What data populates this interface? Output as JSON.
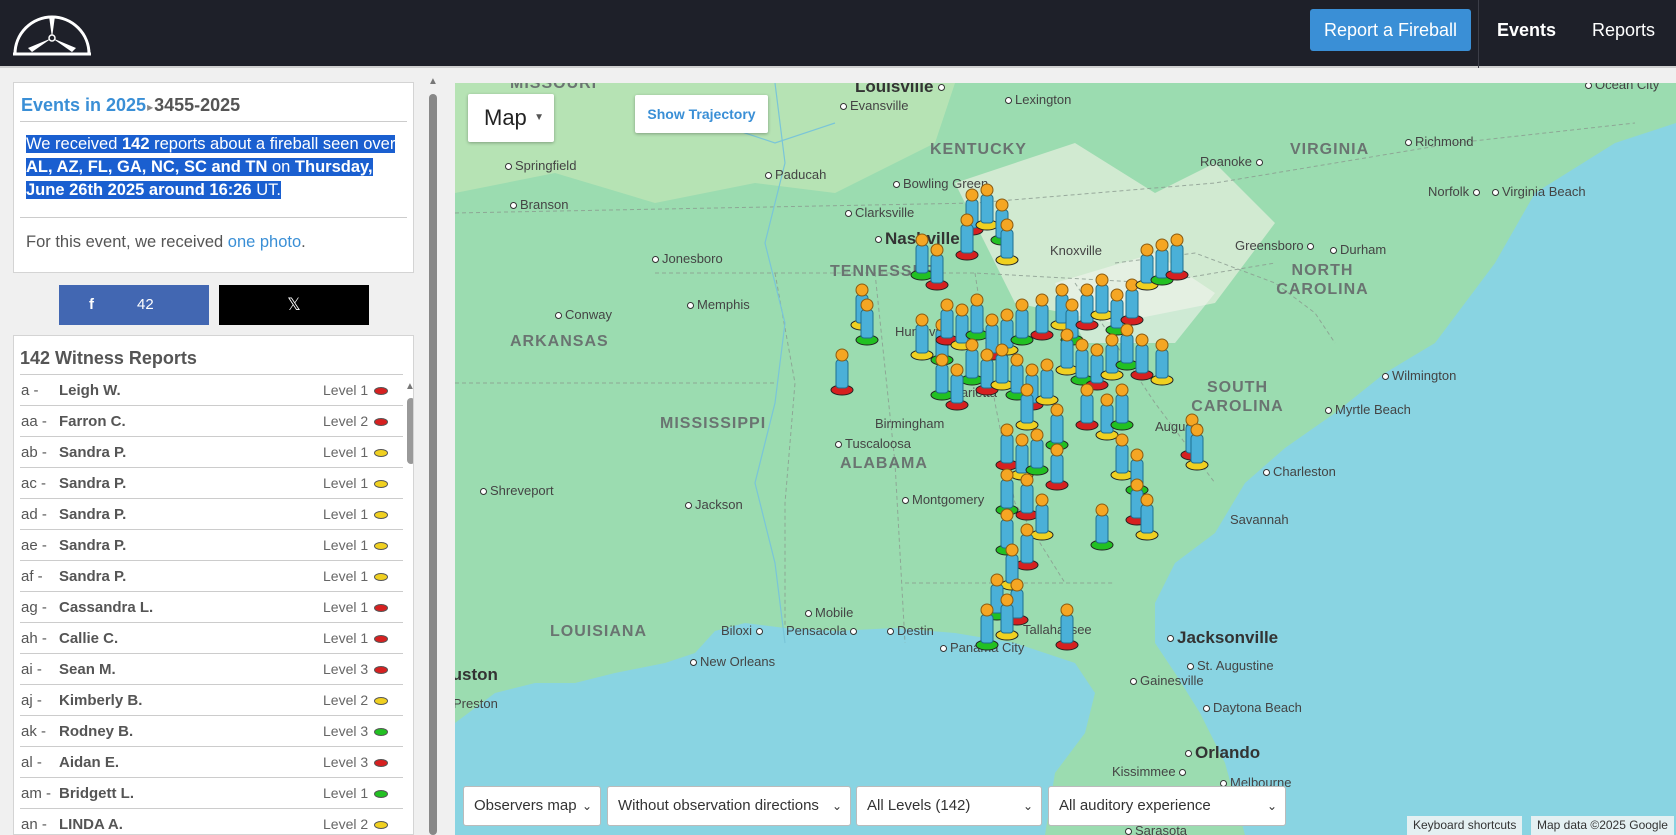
{
  "nav": {
    "report_button": "Report a Fireball",
    "events": "Events",
    "reports": "Reports"
  },
  "event": {
    "breadcrumb_link": "Events in 2025",
    "breadcrumb_sep": "▸",
    "breadcrumb_current": "3455-2025",
    "summary": {
      "p1": "We received ",
      "count": "142",
      "p2": " reports about a fireball seen over ",
      "states": "AL, AZ, FL, GA, NC, SC and TN",
      "p3": " on ",
      "date": "Thursday, June 26th 2025 around 16:26",
      "p4": " UT."
    },
    "photo_text": "For this event, we received ",
    "photo_link": "one photo",
    "photo_end": "."
  },
  "share": {
    "facebook_icon": "f",
    "facebook_count": "42",
    "x_icon": "𝕏"
  },
  "reports": {
    "title": "142 Witness Reports",
    "level_colors": {
      "red": "#d62020",
      "yellow": "#f0d020",
      "green": "#22c022"
    },
    "items": [
      {
        "code": "a -",
        "name": "Leigh W.",
        "level": "Level 1",
        "color": "red"
      },
      {
        "code": "aa -",
        "name": "Farron C.",
        "level": "Level 2",
        "color": "red"
      },
      {
        "code": "ab -",
        "name": "Sandra  P.",
        "level": "Level 1",
        "color": "yellow"
      },
      {
        "code": "ac -",
        "name": "Sandra  P.",
        "level": "Level 1",
        "color": "yellow"
      },
      {
        "code": "ad -",
        "name": "Sandra  P.",
        "level": "Level 1",
        "color": "yellow"
      },
      {
        "code": "ae -",
        "name": "Sandra  P.",
        "level": "Level 1",
        "color": "yellow"
      },
      {
        "code": "af -",
        "name": "Sandra  P.",
        "level": "Level 1",
        "color": "yellow"
      },
      {
        "code": "ag -",
        "name": "Cassandra L.",
        "level": "Level 1",
        "color": "red"
      },
      {
        "code": "ah -",
        "name": "Callie C.",
        "level": "Level 1",
        "color": "red"
      },
      {
        "code": "ai -",
        "name": "Sean M.",
        "level": "Level 3",
        "color": "red"
      },
      {
        "code": "aj -",
        "name": "Kimberly B.",
        "level": "Level 2",
        "color": "yellow"
      },
      {
        "code": "ak -",
        "name": "Rodney  B.",
        "level": "Level 3",
        "color": "green"
      },
      {
        "code": "al -",
        "name": "Aidan E.",
        "level": "Level 3",
        "color": "red"
      },
      {
        "code": "am -",
        "name": "Bridgett L.",
        "level": "Level 1",
        "color": "green"
      },
      {
        "code": "an -",
        "name": "LINDA A.",
        "level": "Level 2",
        "color": "yellow"
      }
    ]
  },
  "map": {
    "type_label": "Map",
    "trajectory_button": "Show Trajectory",
    "filters": {
      "mode": "Observers map",
      "directions": "Without observation directions",
      "levels": "All Levels (142)",
      "auditory": "All auditory experience"
    },
    "footer": {
      "shortcuts": "Keyboard shortcuts",
      "data": "Map data ©2025 Google"
    },
    "states": [
      "MISSOURI",
      "KENTUCKY",
      "VIRGINIA",
      "TENNESSEE",
      "NORTH CAROLINA",
      "ARKANSAS",
      "MISSISSIPPI",
      "ALABAMA",
      "SOUTH CAROLINA",
      "LOUISIANA"
    ],
    "cities": [
      "Louisville",
      "Evansville",
      "Lexington",
      "Springfield",
      "Paducah",
      "Roanoke",
      "Richmond",
      "Norfolk",
      "Virginia Beach",
      "Ocean City",
      "Bowling Green",
      "Clarksville",
      "Nashville",
      "Knoxville",
      "Greensboro",
      "Durham",
      "Jonesboro",
      "Branson",
      "Memphis",
      "Conway",
      "Huntsville",
      "Marietta",
      "Birmingham",
      "Tuscaloosa",
      "Augusta",
      "Wilmington",
      "Myrtle Beach",
      "Charleston",
      "Shreveport",
      "Jackson",
      "Montgomery",
      "Savannah",
      "Mobile",
      "Pensacola",
      "Biloxi",
      "Destin",
      "Panama City",
      "Tallahassee",
      "Jacksonville",
      "New Orleans",
      "St. Augustine",
      "Gainesville",
      "Daytona Beach",
      "Orlando",
      "Kissimmee",
      "Melbourne",
      "Sarasota",
      "Houston",
      "Preston"
    ]
  }
}
